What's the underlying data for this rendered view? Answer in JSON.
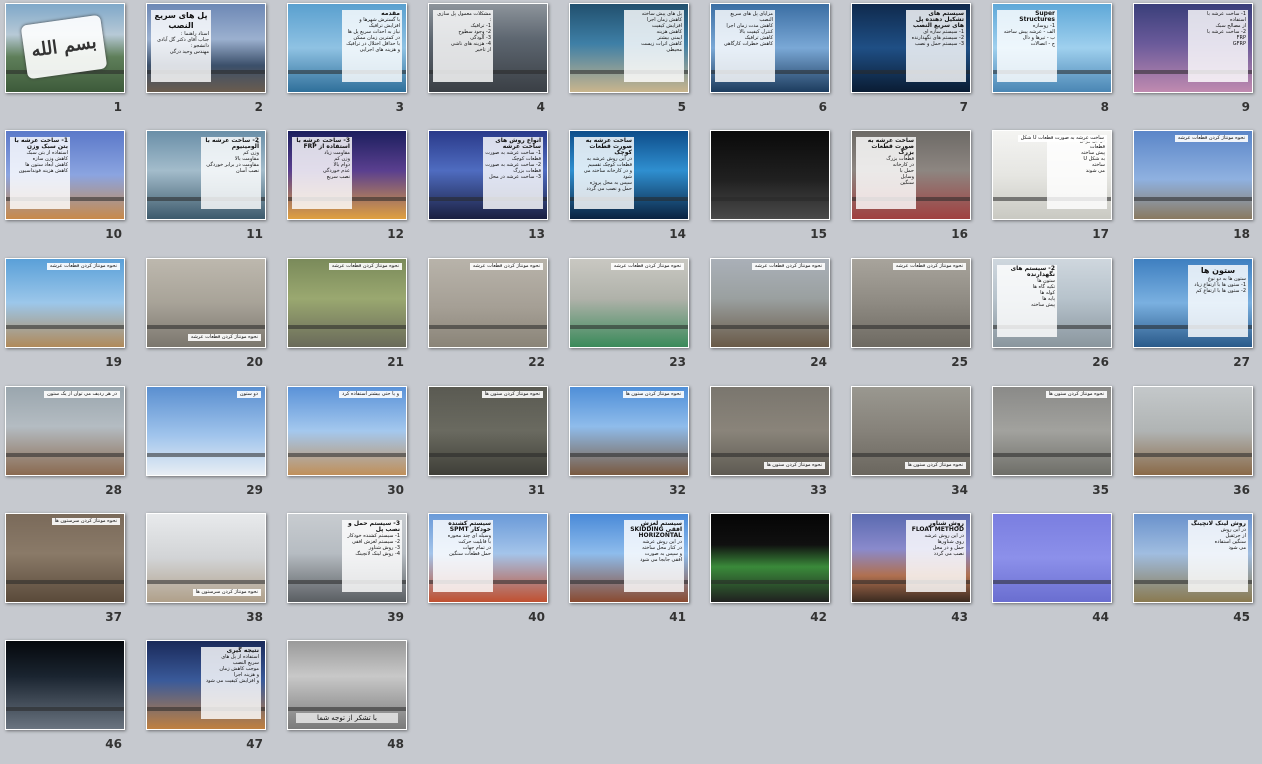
{
  "slides": [
    {
      "num": "1",
      "bg": "linear-gradient(180deg,#7fa8c9 0%,#b7c9d6 35%,#5f7f5a 60%,#3d5a3a 100%)",
      "calligraphy": "بسم الله"
    },
    {
      "num": "2",
      "bg": "linear-gradient(180deg,#6d88b5 0%,#9bb0cf 40%,#3b4f6a 70%,#6a5c4e 100%)",
      "title": "پل های سریع النصب",
      "lines": [
        "استاد راهنما :",
        "جناب آقای دکتر گل آبادی",
        "دانشجو :",
        "مهندس وحید درگی"
      ]
    },
    {
      "num": "3",
      "bg": "linear-gradient(180deg,#5aa0cf 0%,#8fc2e3 50%,#2f6f9a 100%)",
      "head": "مقدمه",
      "lines": [
        "با گسترش شهرها و افزایش ترافیک",
        "نیاز به احداث سریع پل ها",
        "در کمترین زمان ممکن",
        "با حداقل اختلال در ترافیک",
        "و هزینه های اجرایی"
      ]
    },
    {
      "num": "4",
      "bg": "linear-gradient(180deg,#8d949b 0%,#5d6670 40%,#3a3f45 100%)",
      "lines": [
        "مشکلات معمول پل سازی :",
        "1- ترافیک",
        "2- وجود سطوح",
        "3- آلودگی",
        "4- هزینه های ناشی",
        "از تاخیر"
      ]
    },
    {
      "num": "5",
      "bg": "linear-gradient(180deg,#21506e 0%,#3e7fa6 45%,#c9b58d 100%)",
      "lines": [
        "پل های پیش ساخته",
        "کاهش زمان اجرا",
        "افزایش کیفیت",
        "کاهش هزینه",
        "ایمنی بیشتر",
        "کاهش اثرات زیست محیطی"
      ]
    },
    {
      "num": "6",
      "bg": "linear-gradient(180deg,#3b6ea3 0%,#7aa8d6 50%,#1d3c5e 100%)",
      "lines": [
        "مزایای پل های سریع النصب",
        "کاهش مدت زمان اجرا",
        "کنترل کیفیت بالا",
        "کاهش ترافیک",
        "کاهش خطرات کارگاهی"
      ]
    },
    {
      "num": "7",
      "bg": "linear-gradient(180deg,#0f2a4d 0%,#1f4f85 50%,#0a1c33 100%)",
      "head": "سیستم های تشکیل دهنده پل های سریع النصب",
      "lines": [
        "1- سیستم سازه ای",
        "2- سیستم های نگهدارنده",
        "3- سیستم حمل و نصب"
      ]
    },
    {
      "num": "8",
      "bg": "linear-gradient(180deg,#5fa8d8 0%,#9fd0ee 50%,#4a86b4 100%)",
      "head": "Super Structures",
      "lines": [
        "1- روسازه",
        "الف - عرشه پیش ساخته",
        "ب - تیرها و دال",
        "ج - اتصالات"
      ]
    },
    {
      "num": "9",
      "bg": "linear-gradient(180deg,#3a3f7a 0%,#6a5a9a 45%,#c08ab0 100%)",
      "lines": [
        "1- ساخت عرشه با استفاده",
        "از مصالح سبک",
        "2- ساخت عرشه با",
        "FRP",
        "GFRP"
      ]
    },
    {
      "num": "10",
      "bg": "linear-gradient(180deg,#5b79c9 0%,#8ba4e0 50%,#c88a4a 100%)",
      "head": "1- ساخت عرشه با بتن سبک وزن",
      "lines": [
        "استفاده از بتن سبک",
        "کاهش وزن سازه",
        "کاهش ابعاد ستون ها",
        "کاهش هزینه فونداسیون"
      ]
    },
    {
      "num": "11",
      "bg": "linear-gradient(180deg,#6a8fa8 0%,#a3bccb 45%,#3d5a6c 100%)",
      "head": "2- ساخت عرشه با آلومینیوم",
      "lines": [
        "وزن کم",
        "مقاومت بالا",
        "مقاومت در برابر خوردگی",
        "نصب آسان"
      ]
    },
    {
      "num": "12",
      "bg": "linear-gradient(180deg,#1c1f5e 0%,#5a3f8f 45%,#e0a040 100%)",
      "head": "3- ساخت عرشه با استفاده از FRP",
      "lines": [
        "مقاومت زیاد",
        "وزن کم",
        "دوام بالا",
        "عدم خوردگی",
        "نصب سریع"
      ]
    },
    {
      "num": "13",
      "bg": "linear-gradient(180deg,#2a3a8a 0%,#4f6cc0 45%,#1a1f40 100%)",
      "head": "انواع روش های ساخت عرشه",
      "lines": [
        "1- ساخت عرشه به صورت قطعات کوچک",
        "2- ساخت عرشه به صورت قطعات بزرگ",
        "3- ساخت عرشه در محل"
      ]
    },
    {
      "num": "14",
      "bg": "linear-gradient(180deg,#0e4d8a 0%,#2f8fd0 45%,#0a2240 100%)",
      "head": "ساخت عرشه به صورت قطعات کوچک",
      "lines": [
        "در این روش عرشه به قطعات کوچک تقسیم",
        "و در کارخانه ساخته می شود",
        "سپس به محل پروژه",
        "حمل و نصب می گردد"
      ]
    },
    {
      "num": "15",
      "bg": "linear-gradient(180deg,#0a0a0a 0%,#202020 55%,#4a4a4a 100%)"
    },
    {
      "num": "16",
      "bg": "linear-gradient(180deg,#6d6a66 0%,#8d8681 45%,#a04040 100%)",
      "head": "ساخت عرشه به صورت قطعات بزرگ",
      "lines": [
        "قطعات بزرگ",
        "در کارخانه",
        "حمل با",
        "وسایل",
        "سنگین"
      ]
    },
    {
      "num": "17",
      "bg": "linear-gradient(180deg,#f4f4f2 0%,#e6e6e2 50%,#c9c9c2 100%)",
      "label": "ساخت عرشه به صورت قطعات U شکل",
      "lines": [
        "در این روش",
        "قطعات",
        "پیش ساخته",
        "به شکل U",
        "ساخته",
        "می شوند"
      ]
    },
    {
      "num": "18",
      "bg": "linear-gradient(180deg,#5b86c8 0%,#8fb1e0 55%,#8a7a60 100%)",
      "label": "نحوه مونتاژ کردن قطعات عرشه"
    },
    {
      "num": "19",
      "bg": "linear-gradient(180deg,#5aa0d8 0%,#9cc7ea 50%,#b08a5a 100%)",
      "label": "نحوه مونتاژ کردن قطعات عرشه"
    },
    {
      "num": "20",
      "bg": "linear-gradient(180deg,#bdb8ae 0%,#a8a398 50%,#7b776e 100%)",
      "label": "نحوه مونتاژ کردن قطعات عرشه"
    },
    {
      "num": "21",
      "bg": "linear-gradient(180deg,#7a8a5a 0%,#9aa870 45%,#6a6a5a 100%)",
      "label": "نحوه مونتاژ کردن قطعات عرشه"
    },
    {
      "num": "22",
      "bg": "linear-gradient(180deg,#b8b3aa 0%,#a59f95 55%,#8a8478 100%)",
      "label": "نحوه مونتاژ کردن قطعات عرشه"
    },
    {
      "num": "23",
      "bg": "linear-gradient(180deg,#c9c8c2 0%,#b0b2aa 45%,#3a8a5a 100%)",
      "label": "نحوه مونتاژ کردن قطعات عرشه"
    },
    {
      "num": "24",
      "bg": "linear-gradient(180deg,#aab0b8 0%,#9aa0a0 45%,#6a5a48 100%)",
      "label": "نحوه مونتاژ کردن قطعات عرشه"
    },
    {
      "num": "25",
      "bg": "linear-gradient(180deg,#a8a49c 0%,#8e8a82 50%,#6e6a62 100%)",
      "label": "نحوه مونتاژ کردن قطعات عرشه"
    },
    {
      "num": "26",
      "bg": "linear-gradient(180deg,#cfd7de 0%,#b7c3cc 45%,#8a969e 100%)",
      "head": "2- سیستم های نگهدارنده",
      "lines": [
        "ستون ها",
        "تکیه گاه ها",
        "کوله ها",
        "پایه ها",
        "پیش ساخته"
      ]
    },
    {
      "num": "27",
      "bg": "linear-gradient(180deg,#3e7fc0 0%,#7ab0e0 50%,#2a5a8a 100%)",
      "title": "ستون ها",
      "lines": [
        "ستون ها به دو نوع",
        "1- ستون ها با ارتفاع زیاد",
        "2- ستون ها با ارتفاع کم"
      ]
    },
    {
      "num": "28",
      "bg": "linear-gradient(180deg,#9aa6ae 0%,#b4bcc2 45%,#8a6a50 100%)",
      "label": "در هر ردیف می توان از یک ستون"
    },
    {
      "num": "29",
      "bg": "linear-gradient(180deg,#5a8fd0 0%,#a0c4ec 55%,#e8eef4 100%)",
      "label": "دو ستون"
    },
    {
      "num": "30",
      "bg": "linear-gradient(180deg,#5a92d8 0%,#a4c8ee 50%,#c0905a 100%)",
      "label": "و یا حتی بیشتر استفاده کرد"
    },
    {
      "num": "31",
      "bg": "linear-gradient(180deg,#5a5a52 0%,#6a6a60 50%,#3f3f38 100%)",
      "label": "نحوه مونتاژ کردن ستون ها"
    },
    {
      "num": "32",
      "bg": "linear-gradient(180deg,#4f8fd8 0%,#8fbceb 45%,#7a5a40 100%)",
      "label": "نحوه مونتاژ کردن ستون ها"
    },
    {
      "num": "33",
      "bg": "linear-gradient(180deg,#7a766e 0%,#8a847a 50%,#5e5a52 100%)",
      "label": "نحوه مونتاژ کردن ستون ها"
    },
    {
      "num": "34",
      "bg": "linear-gradient(180deg,#9a9890 0%,#86827a 50%,#6a665e 100%)",
      "label": "نحوه مونتاژ کردن ستون ها"
    },
    {
      "num": "35",
      "bg": "linear-gradient(180deg,#8a8a88 0%,#a2a29e 50%,#6e6e68 100%)",
      "label": "نحوه مونتاژ کردن ستون ها"
    },
    {
      "num": "36",
      "bg": "linear-gradient(180deg,#c4c8ca 0%,#b0b4b4 50%,#8a6a48 100%)"
    },
    {
      "num": "37",
      "bg": "linear-gradient(180deg,#7a6a5a 0%,#8a7a68 45%,#5a4a3a 100%)",
      "label": "نحوه مونتاژ کردن سرستون ها"
    },
    {
      "num": "38",
      "bg": "linear-gradient(180deg,#e8eaec 0%,#d2d4d6 50%,#b0a08a 100%)",
      "label": "نحوه مونتاژ کردن سرستون ها"
    },
    {
      "num": "39",
      "bg": "linear-gradient(180deg,#c8ccd0 0%,#b6bcc2 45%,#5a5e62 100%)",
      "head": "3- سیستم حمل و نصب پل",
      "lines": [
        "1- سیستم کشنده خودکار",
        "2- سیستم لغزش افقی",
        "3- روش شناور",
        "4- روش لینک لانچینگ"
      ]
    },
    {
      "num": "40",
      "bg": "linear-gradient(180deg,#6a9ad8 0%,#a4c4ea 45%,#c05030 100%)",
      "head": "سیستم کشنده خودکار SPMT",
      "lines": [
        "وسیله ای چند محوره",
        "با قابلیت حرکت",
        "در تمام جهات",
        "حمل قطعات سنگین"
      ]
    },
    {
      "num": "41",
      "bg": "linear-gradient(180deg,#4a8ad8 0%,#8ebcec 45%,#8a4a30 100%)",
      "head": "سیستم لغزش افقی SKIDDING HORIZONTAL",
      "lines": [
        "در این روش عرشه",
        "در کنار محل ساخته",
        "و سپس به صورت",
        "افقی جابجا می شود"
      ]
    },
    {
      "num": "42",
      "bg": "linear-gradient(180deg,#050505 0%,#101010 35%,#3a8a3a 60%,#202020 100%)"
    },
    {
      "num": "43",
      "bg": "linear-gradient(180deg,#5a6ab0 0%,#8a8acc 40%,#b07050 70%,#3a2a20 100%)",
      "head": "روش شناور FLOAT METHOD",
      "lines": [
        "در این روش عرشه",
        "روی شناورها",
        "حمل و در محل",
        "نصب می گردد"
      ]
    },
    {
      "num": "44",
      "bg": "linear-gradient(180deg,#7a7ee0 0%,#8c90ea 50%,#6a6ed0 100%)"
    },
    {
      "num": "45",
      "bg": "linear-gradient(180deg,#6a92cc 0%,#a0bde0 45%,#8a7a50 100%)",
      "head": "روش لینک لانچینگ",
      "lines": [
        "در این روش",
        "از جرثقیل",
        "سنگین استفاده",
        "می شود"
      ]
    },
    {
      "num": "46",
      "bg": "linear-gradient(180deg,#05080c 0%,#1a2430 40%,#6a7480 100%)"
    },
    {
      "num": "47",
      "bg": "linear-gradient(180deg,#1a2a5a 0%,#3a5a9a 45%,#c08040 100%)",
      "head": "نتیجه گیری",
      "lines": [
        "استفاده از پل های",
        "سریع النصب",
        "موجب کاهش زمان",
        "و هزینه اجرا",
        "و افزایش کیفیت می شود"
      ]
    },
    {
      "num": "48",
      "bg": "linear-gradient(180deg,#9a9a9a 0%,#c8c8c8 40%,#7a7a7a 100%)",
      "label": "با تشکر از توجه شما"
    }
  ]
}
